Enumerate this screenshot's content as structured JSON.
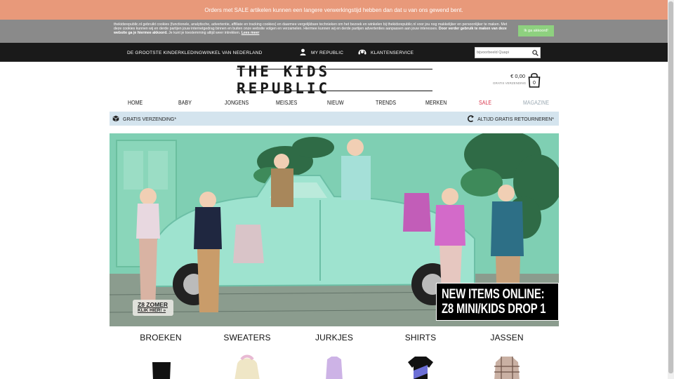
{
  "sale_notice": "Orders met SALE artikelen kunnen een langere verwerkingstijd hebben dan dat u van ons gewend bent.",
  "cookie": {
    "text": "thekidsrepublic.nl gebruikt cookies (functionele, analytische, advertentie, affiliate en tracking cookies) en daarmee vergelijkbare technieken om het bezoek en winkelen bij thekidsrepublic.nl voor jou nog makkelijker en persoonlijker te maken. Met deze cookies kunnen wij en derde partijen jouw internetgedrag binnen en buiten onze website volgen en verzamelen. Hiermee kunnen wij en derde partijen advertenties aanpassen aan jouw interesses.",
    "bold_text": "Door verder gebruik te maken van deze website ga je hiermee akkoord.",
    "tail_text": "Je kunt je toestemming altijd weer intrekken.",
    "read_more": "Lees meer",
    "accept_button": "Ik ga akkoord!"
  },
  "top_bar": {
    "tagline": "De grootste kinderkledingwinkel van Nederland",
    "my_republic": "My Republic",
    "customer_service": "Klantenservice",
    "search_placeholder": "bijvoorbeeld Quapi"
  },
  "logo": "THE KIDS REPUBLIC",
  "cart": {
    "price": "€ 0,00",
    "shipping": "GRATIS VERZENDING",
    "count": "0"
  },
  "nav": [
    {
      "label": "HOME",
      "color": "#111111"
    },
    {
      "label": "BABY",
      "color": "#111111"
    },
    {
      "label": "JONGENS",
      "color": "#111111"
    },
    {
      "label": "MEISJES",
      "color": "#111111"
    },
    {
      "label": "NIEUW",
      "color": "#111111"
    },
    {
      "label": "TRENDS",
      "color": "#111111"
    },
    {
      "label": "MERKEN",
      "color": "#111111"
    },
    {
      "label": "SALE",
      "color": "#d8334a"
    },
    {
      "label": "MAGAZINE",
      "color": "#9aa8b2"
    }
  ],
  "shipping_bar": {
    "left": "Gratis verzending*",
    "right": "Altijd gratis retourneren*"
  },
  "hero": {
    "headline_1": "NEW ITEMS ONLINE:",
    "headline_2": "Z8 MINI/KIDS DROP 1",
    "button_1": "Z8 ZOMER",
    "button_2": "KLIK HIER! »"
  },
  "categories": [
    "BROEKEN",
    "SWEATERS",
    "JURKJES",
    "SHIRTS",
    "JASSEN"
  ]
}
